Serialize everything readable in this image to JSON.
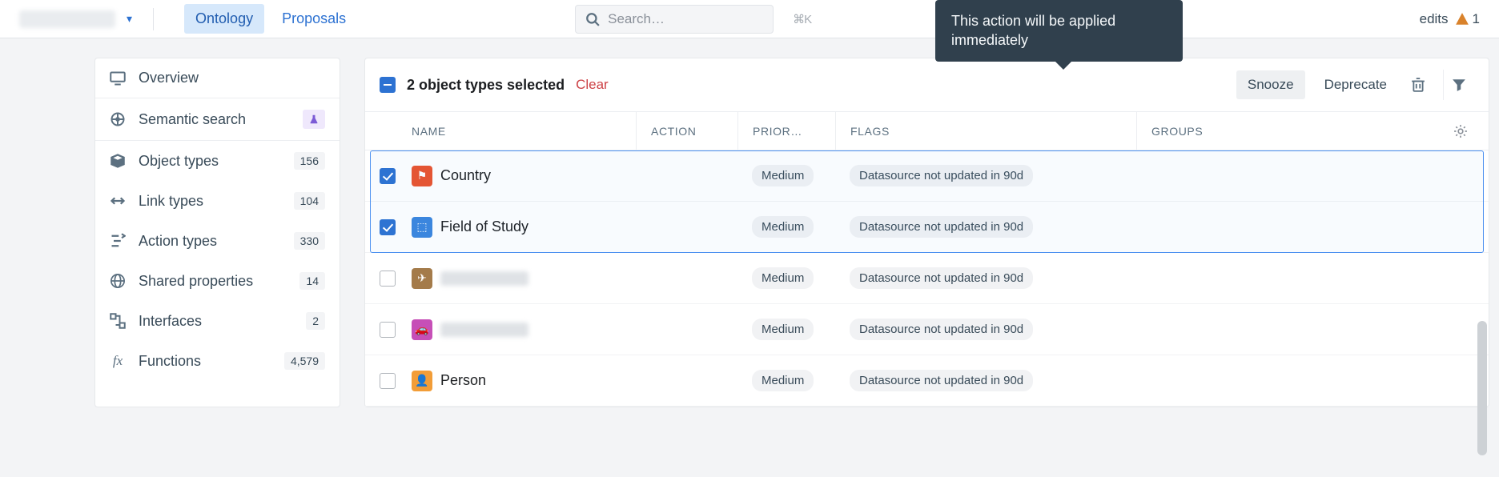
{
  "topbar": {
    "tabs": {
      "ontology": "Ontology",
      "proposals": "Proposals"
    },
    "search_placeholder": "Search…",
    "search_shortcut": "⌘K",
    "edits_label": "edits",
    "warn_count": "1"
  },
  "tooltip": "This action will be applied immediately",
  "sidebar": {
    "overview": "Overview",
    "semantic_search": "Semantic search",
    "items": [
      {
        "label": "Object types",
        "count": "156"
      },
      {
        "label": "Link types",
        "count": "104"
      },
      {
        "label": "Action types",
        "count": "330"
      },
      {
        "label": "Shared properties",
        "count": "14"
      },
      {
        "label": "Interfaces",
        "count": "2"
      },
      {
        "label": "Functions",
        "count": "4,579"
      }
    ]
  },
  "selection": {
    "summary": "2 object types selected",
    "clear": "Clear",
    "snooze": "Snooze",
    "deprecate": "Deprecate"
  },
  "columns": {
    "name": "Name",
    "action": "Action",
    "prior": "Prior…",
    "flags": "Flags",
    "groups": "Groups"
  },
  "rows": [
    {
      "checked": true,
      "icon_color": "#eb532d",
      "icon_glyph": "⚑",
      "name": "Country",
      "blurred": false,
      "priority": "Medium",
      "flag": "Datasource not updated in 90d"
    },
    {
      "checked": true,
      "icon_color": "#3b86de",
      "icon_glyph": "⬚",
      "name": "Field of Study",
      "blurred": false,
      "priority": "Medium",
      "flag": "Datasource not updated in 90d"
    },
    {
      "checked": false,
      "icon_color": "#a47b4a",
      "icon_glyph": "✈",
      "name": "",
      "blurred": true,
      "priority": "Medium",
      "flag": "Datasource not updated in 90d"
    },
    {
      "checked": false,
      "icon_color": "#c64fb7",
      "icon_glyph": "🚗",
      "name": "",
      "blurred": true,
      "priority": "Medium",
      "flag": "Datasource not updated in 90d"
    },
    {
      "checked": false,
      "icon_color": "#f29d38",
      "icon_glyph": "👤",
      "name": "Person",
      "blurred": false,
      "priority": "Medium",
      "flag": "Datasource not updated in 90d"
    }
  ]
}
